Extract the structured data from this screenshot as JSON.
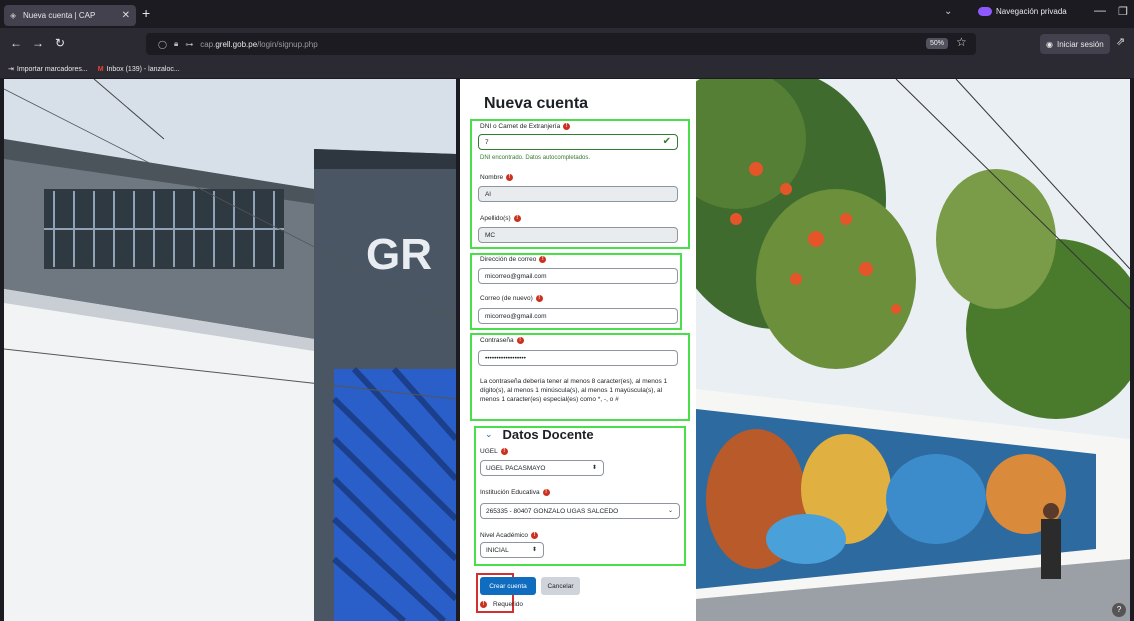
{
  "browser": {
    "tab_title": "Nueva cuenta | CAP",
    "new_tab": "+",
    "private_label": "Navegación privada",
    "url_prefix": "cap.",
    "url_domain": "grell.gob.pe",
    "url_path": "/login/signup.php",
    "zoom": "50%",
    "signin_label": "Iniciar sesión",
    "bookmarks": [
      {
        "label": "Importar marcadores..."
      },
      {
        "label": "Inbox (139) - lanzaloc..."
      }
    ]
  },
  "form": {
    "title": "Nueva cuenta",
    "dni": {
      "label": "DNI o Carnet de Extranjería",
      "value": "7",
      "help": "DNI encontrado. Datos autocompletados."
    },
    "nombre": {
      "label": "Nombre",
      "value": "Al"
    },
    "apellidos": {
      "label": "Apellido(s)",
      "value": "MC"
    },
    "email": {
      "label": "Dirección de correo",
      "value": "micorreo@gmail.com"
    },
    "email2": {
      "label": "Correo (de nuevo)",
      "value": "micorreo@gmail.com"
    },
    "password": {
      "label": "Contraseña",
      "value": "••••••••••••••••••",
      "help": "La contraseña debería tener al menos 8 caracter(es), al menos 1 dígito(s), al menos 1 minúscula(s), al menos 1 mayúscula(s), al menos 1 caracter(es) especial(es) como *, -, o #"
    },
    "section_title": "Datos Docente",
    "ugel": {
      "label": "UGEL",
      "value": "UGEL PACASMAYO"
    },
    "institucion": {
      "label": "Institución Educativa",
      "value": "265335 - 80407 GONZALO UGAS SALCEDO"
    },
    "nivel": {
      "label": "Nivel Académico",
      "value": "INICIAL"
    },
    "submit_label": "Crear cuenta",
    "cancel_label": "Cancelar",
    "required_note": "Requerido"
  },
  "help_fab": "?",
  "colors": {
    "primary": "#0f6cbf",
    "highlight_green": "#4ade4a",
    "highlight_red": "#d42f2f",
    "required": "#ca3120"
  }
}
